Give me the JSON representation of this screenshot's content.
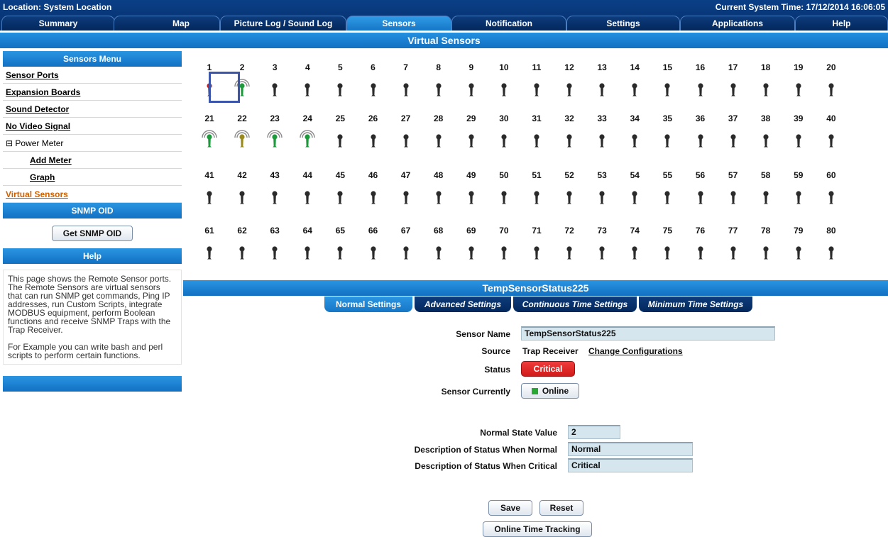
{
  "header": {
    "location": "Location: System Location",
    "system_time": "Current System Time: 17/12/2014 16:06:05"
  },
  "tabs": [
    {
      "label": "Summary"
    },
    {
      "label": "Map"
    },
    {
      "label": "Picture Log / Sound Log"
    },
    {
      "label": "Sensors"
    },
    {
      "label": "Notification"
    },
    {
      "label": "Settings"
    },
    {
      "label": "Applications"
    },
    {
      "label": "Help"
    }
  ],
  "page_title": "Virtual Sensors",
  "sidebar": {
    "menu_title": "Sensors Menu",
    "items": [
      {
        "label": "Sensor Ports"
      },
      {
        "label": "Expansion Boards"
      },
      {
        "label": "Sound Detector"
      },
      {
        "label": "No Video Signal"
      },
      {
        "label": "⊟ Power Meter"
      },
      {
        "label": "Add Meter"
      },
      {
        "label": "Graph"
      },
      {
        "label": "Virtual Sensors"
      }
    ],
    "snmp_title": "SNMP OID",
    "snmp_button": "Get SNMP OID",
    "help_title": "Help",
    "help_paragraph_1": "This page shows the Remote Sensor ports. The Remote Sensors are virtual sensors that can run SNMP get commands, Ping IP addresses, run Custom Scripts, integrate MODBUS equipment, perform Boolean functions and receive SNMP Traps with the Trap Receiver.",
    "help_paragraph_2": "For Example you can write bash and perl scripts to perform certain functions."
  },
  "sensor_grid": {
    "rows": [
      {
        "numbers": [
          "1",
          "2",
          "3",
          "4",
          "5",
          "6",
          "7",
          "8",
          "9",
          "10",
          "11",
          "12",
          "13",
          "14",
          "15",
          "16",
          "17",
          "18",
          "19",
          "20"
        ]
      },
      {
        "numbers": [
          "21",
          "22",
          "23",
          "24",
          "25",
          "26",
          "27",
          "28",
          "29",
          "30",
          "31",
          "32",
          "33",
          "34",
          "35",
          "36",
          "37",
          "38",
          "39",
          "40"
        ]
      },
      {
        "numbers": [
          "41",
          "42",
          "43",
          "44",
          "45",
          "46",
          "47",
          "48",
          "49",
          "50",
          "51",
          "52",
          "53",
          "54",
          "55",
          "56",
          "57",
          "58",
          "59",
          "60"
        ]
      },
      {
        "numbers": [
          "61",
          "62",
          "63",
          "64",
          "65",
          "66",
          "67",
          "68",
          "69",
          "70",
          "71",
          "72",
          "73",
          "74",
          "75",
          "76",
          "77",
          "78",
          "79",
          "80"
        ]
      }
    ],
    "states": {
      "1": "critical-red",
      "2": "online-green",
      "21": "online-green",
      "22": "online-olive",
      "23": "online-green",
      "24": "online-green"
    },
    "colors": {
      "inactive": "#2b2b2b",
      "critical-red": "#c81e1e",
      "online-green": "#1e9a3c",
      "online-olive": "#9a8a1e"
    },
    "selected": "1"
  },
  "detail": {
    "title": "TempSensorStatus225",
    "subtabs": [
      {
        "label": "Normal Settings"
      },
      {
        "label": "Advanced Settings"
      },
      {
        "label": "Continuous Time Settings"
      },
      {
        "label": "Minimum Time Settings"
      }
    ],
    "sensor_name_label": "Sensor Name",
    "sensor_name_value": "TempSensorStatus225",
    "source_label": "Source",
    "source_value": "Trap Receiver",
    "change_config": "Change Configurations",
    "status_label": "Status",
    "status_value": "Critical",
    "currently_label": "Sensor Currently",
    "currently_value": "Online",
    "normal_state_label": "Normal State Value",
    "normal_state_value": "2",
    "desc_normal_label": "Description of Status When Normal",
    "desc_normal_value": "Normal",
    "desc_critical_label": "Description of Status When Critical",
    "desc_critical_value": "Critical",
    "save_button": "Save",
    "reset_button": "Reset",
    "tracking_button": "Online Time Tracking"
  }
}
